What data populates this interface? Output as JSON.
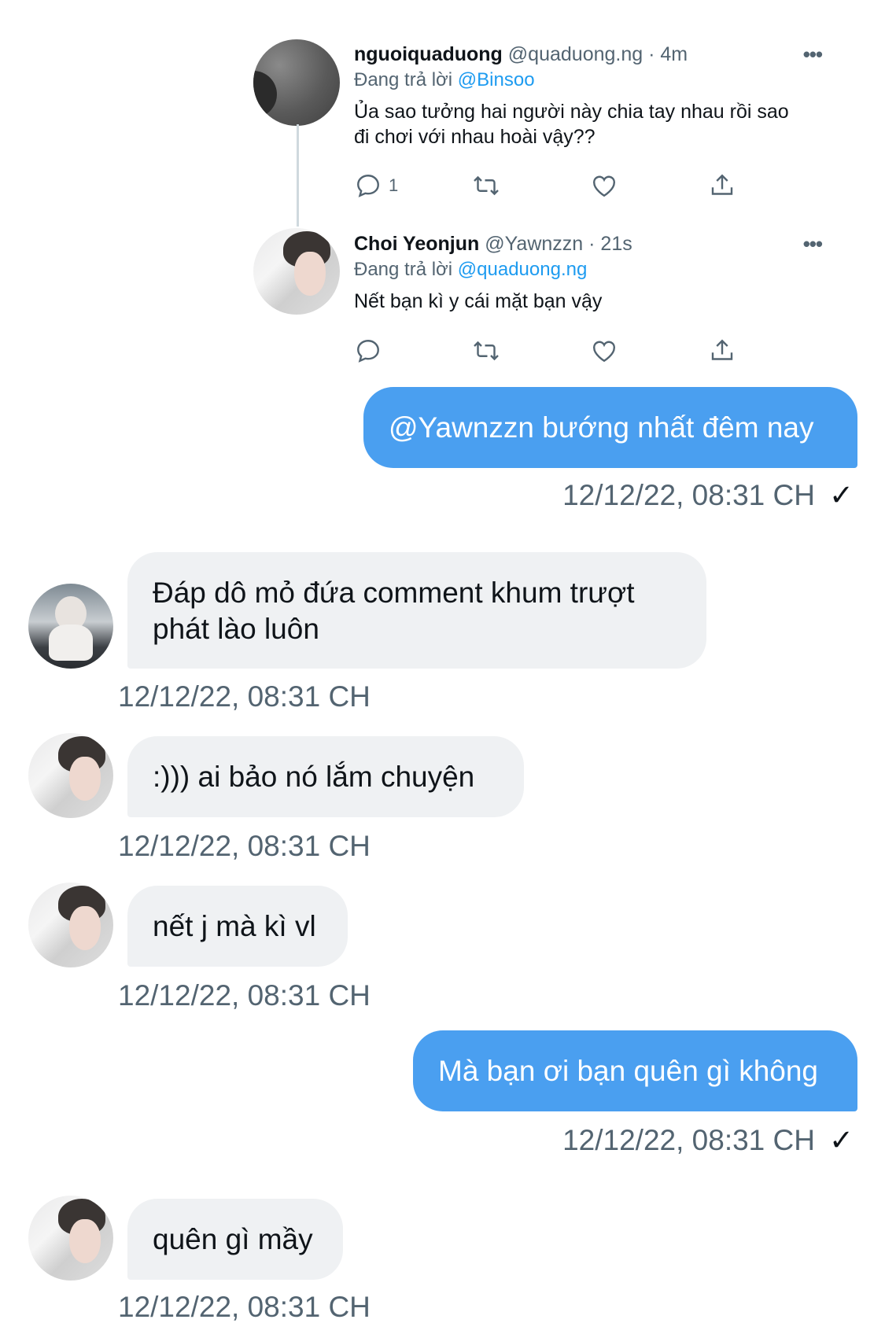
{
  "tweets": [
    {
      "display_name": "nguoiquaduong",
      "handle": "@quaduong.ng",
      "time": "· 4m",
      "replying_prefix": "Đang trả lời",
      "replying_to": "@Binsoo",
      "text_line1": "Ủa sao tưởng hai người này chia tay nhau rồi sao",
      "text_line2": "đi chơi với nhau hoài vậy??",
      "reply_count": "1",
      "more_icon": "more-icon"
    },
    {
      "display_name": "Choi Yeonjun",
      "handle": "@Yawnzzn",
      "time": "· 21s",
      "replying_prefix": "Đang trả lời",
      "replying_to": "@quaduong.ng",
      "text_line1": "Nết bạn kì y cái mặt bạn vậy",
      "reply_count": "",
      "more_icon": "more-icon"
    }
  ],
  "messages": [
    {
      "direction": "out",
      "text": "@Yawnzzn bướng nhất đêm nay",
      "timestamp": "12/12/22, 08:31 CH",
      "status": "✓"
    },
    {
      "direction": "in",
      "text_line1": "Đáp dô mỏ đứa comment khum trượt",
      "text_line2": "phát lào luôn",
      "timestamp": "12/12/22, 08:31 CH"
    },
    {
      "direction": "in",
      "text": ":))) ai bảo nó lắm chuyện",
      "timestamp": "12/12/22, 08:31 CH"
    },
    {
      "direction": "in",
      "text": "nết j mà kì vl",
      "timestamp": "12/12/22, 08:31 CH"
    },
    {
      "direction": "out",
      "text": "Mà bạn ơi bạn quên gì không",
      "timestamp": "12/12/22, 08:31 CH",
      "status": "✓"
    },
    {
      "direction": "in",
      "text": "quên gì mầy",
      "timestamp": "12/12/22, 08:31 CH"
    }
  ],
  "colors": {
    "accent": "#1d9bf0",
    "bubble_out": "#4a9ff0",
    "bubble_in": "#eff1f3",
    "muted": "#536471"
  }
}
